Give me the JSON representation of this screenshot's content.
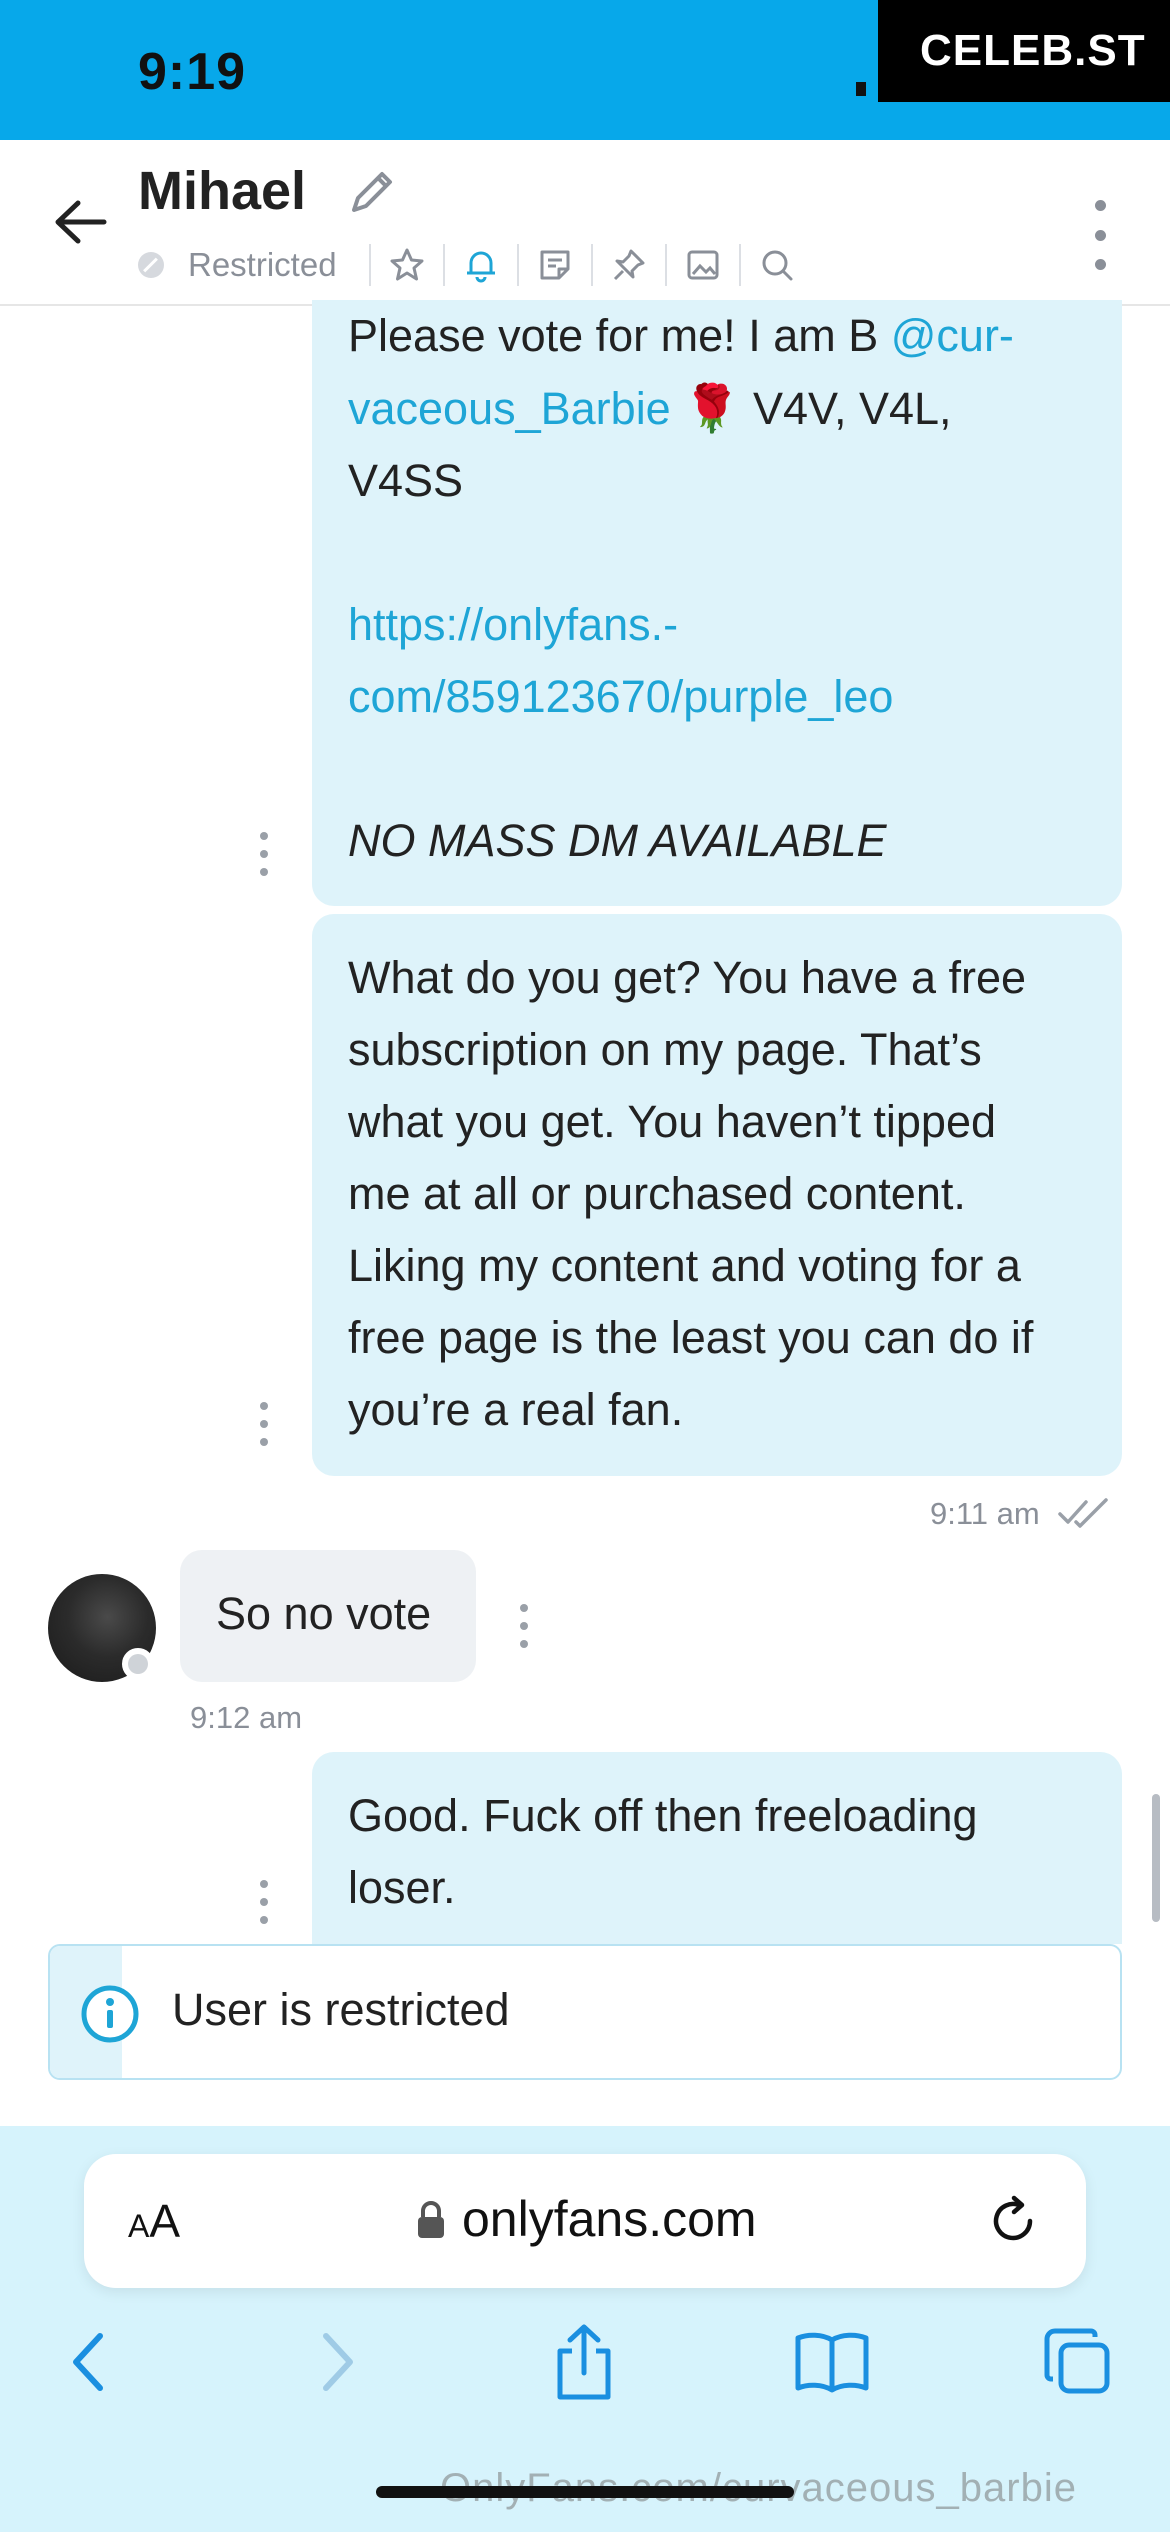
{
  "status_bar": {
    "time": "9:19",
    "watermark_top": "CELEB.ST"
  },
  "header": {
    "name": "Mihael",
    "status": "Restricted",
    "icons": [
      "back-arrow-icon",
      "edit-pencil-icon",
      "star-icon",
      "bell-icon",
      "note-icon",
      "pin-icon",
      "image-icon",
      "search-icon",
      "more-vertical-icon"
    ]
  },
  "messages": {
    "m1": {
      "line1": "Please vote for me! I am B ",
      "mention_a": "@cur-",
      "mention_b": "vaceous_Barbie",
      "emoji": "🌹",
      "line2_rest": " V4V, V4L,",
      "line3": "V4SS",
      "link_a": "https://onlyfans.-",
      "link_b": "com/859123670/purple_leo",
      "note": "NO MASS DM AVAILABLE"
    },
    "m2": {
      "lines": [
        "What do you get? You have a free",
        "subscription on my page. That’s",
        "what you get. You haven’t tipped",
        "me at all or purchased content.",
        "Liking my content and voting for a",
        "free page is the least you can do if",
        "you’re a real fan."
      ],
      "time": "9:11 am"
    },
    "m3": {
      "text": "So no vote",
      "time": "9:12 am"
    },
    "m4": {
      "lines": [
        "Good. Fuck off then freeloading",
        "loser."
      ]
    }
  },
  "notice": {
    "text": "User is restricted"
  },
  "browser": {
    "text_size_label_small": "A",
    "text_size_label_large": "A",
    "url": "onlyfans.com"
  },
  "watermark_bottom": "OnlyFans.com/curvaceous_barbie",
  "colors": {
    "status_bar": "#07a8ea",
    "accent": "#1ea5d6",
    "bubble_out": "#def3fa",
    "bubble_in": "#eef1f4",
    "browser_bg": "#d6f3fc"
  }
}
